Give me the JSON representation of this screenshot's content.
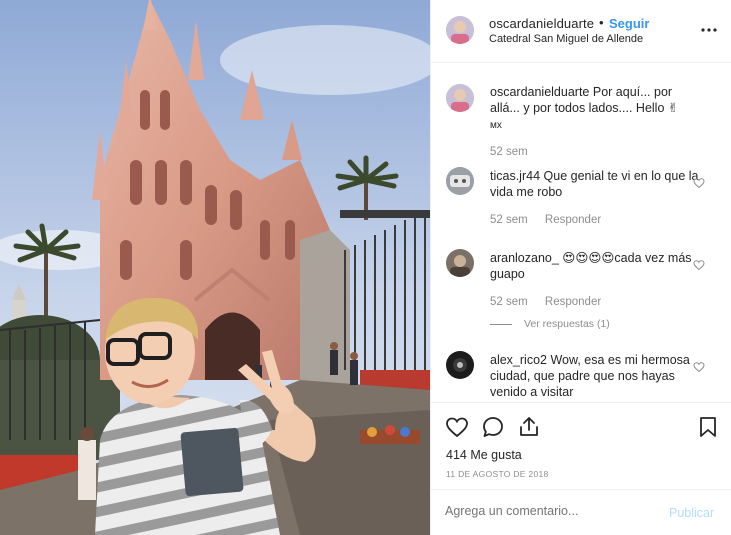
{
  "post": {
    "username": "oscardanielduarte",
    "separator": "•",
    "follow_label": "Seguir",
    "location": "Catedral San Miguel de Allende",
    "more_icon": "ellipsis-icon"
  },
  "comments": [
    {
      "username": "oscardanielduarte",
      "text": "Por aquí... por allá... y por todos lados.... Hello ✌",
      "text_extra": "мх",
      "time": "52 sem",
      "reply_label": ""
    },
    {
      "username": "ticas.jr44",
      "text": "Que genial te vi en lo que la vida me robo",
      "time": "52 sem",
      "reply_label": "Responder"
    },
    {
      "username": "aranlozano_",
      "text": "😍😍😍😍cada vez más guapo",
      "time": "52 sem",
      "reply_label": "Responder",
      "view_replies": "Ver respuestas (1)"
    },
    {
      "username": "alex_rico2",
      "text": "Wow, esa es mi hermosa ciudad, que padre que nos hayas venido a visitar"
    }
  ],
  "actions": {
    "like_icon": "heart-icon",
    "comment_icon": "comment-icon",
    "share_icon": "share-icon",
    "save_icon": "bookmark-icon",
    "likes_text": "414 Me gusta",
    "date": "11 DE AGOSTO DE 2018"
  },
  "composer": {
    "placeholder": "Agrega un comentario...",
    "publish_label": "Publicar"
  },
  "colors": {
    "link_blue": "#3897f0",
    "publish_disabled": "#b2dffc",
    "muted_text": "#8e8e8e",
    "border": "#efefef"
  }
}
